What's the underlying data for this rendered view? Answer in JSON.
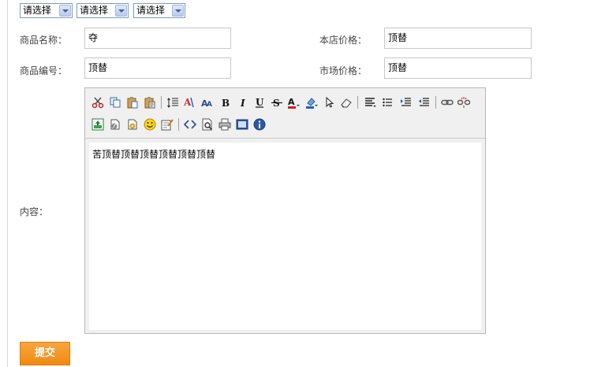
{
  "category_selects": [
    {
      "selected": "请选择"
    },
    {
      "selected": "请选择"
    },
    {
      "selected": "请选择"
    }
  ],
  "form": {
    "product_name_label": "商品名称：",
    "product_name_value": "夺",
    "store_price_label": "本店价格：",
    "store_price_value": "顶替",
    "product_code_label": "商品编号：",
    "product_code_value": "顶替",
    "market_price_label": "市场价格：",
    "market_price_value": "顶替",
    "content_label": "内容："
  },
  "editor": {
    "content": "苦顶替顶替顶替顶替顶替顶替",
    "toolbar_icons": [
      "cut-icon",
      "copy-icon",
      "paste-icon",
      "paste-text-icon",
      "line-height-icon",
      "font-family-icon",
      "font-size-icon",
      "bold-icon",
      "italic-icon",
      "underline-icon",
      "strikethrough-icon",
      "font-color-icon",
      "background-color-icon",
      "select-icon",
      "eraser-icon",
      "align-icon",
      "list-icon",
      "indent-icon",
      "outdent-icon",
      "link-icon",
      "unlink-icon",
      "image-icon",
      "flash-icon",
      "media-icon",
      "emoticon-icon",
      "special-char-icon",
      "source-icon",
      "preview-icon",
      "print-icon",
      "fullscreen-icon",
      "about-icon"
    ]
  },
  "submit_label": "提交",
  "colors": {
    "submit_bg": "#ef8a12",
    "input_border": "#c8c8c8",
    "select_border": "#7f9db9"
  }
}
